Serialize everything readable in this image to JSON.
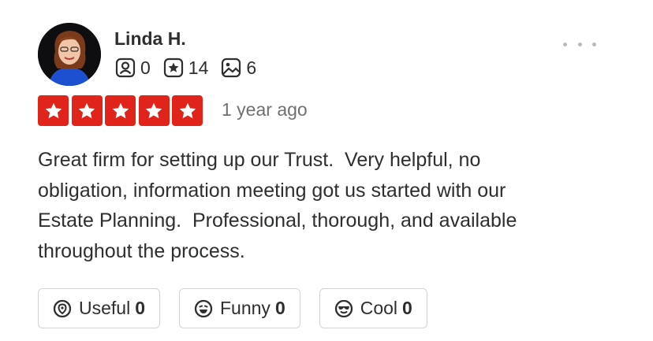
{
  "user": {
    "name": "Linda H.",
    "friends_count": "0",
    "reviews_count": "14",
    "photos_count": "6"
  },
  "review": {
    "rating": 5,
    "rating_max": 5,
    "date": "1 year ago",
    "text": "Great firm for setting up our Trust.  Very helpful, no\nobligation, information meeting got us started with our\nEstate Planning.  Professional, thorough, and available\nthroughout the process."
  },
  "reactions": [
    {
      "label": "Useful",
      "count": "0",
      "icon": "useful-icon"
    },
    {
      "label": "Funny",
      "count": "0",
      "icon": "funny-icon"
    },
    {
      "label": "Cool",
      "count": "0",
      "icon": "cool-icon"
    }
  ],
  "colors": {
    "star_red": "#e0241b",
    "text": "#2d2e2f",
    "muted": "#6e7072",
    "border": "#d3d3d3"
  },
  "icons": {
    "friends": "friends-icon",
    "reviews": "review-star-icon",
    "photos": "photo-icon",
    "more": "more-options-icon"
  }
}
